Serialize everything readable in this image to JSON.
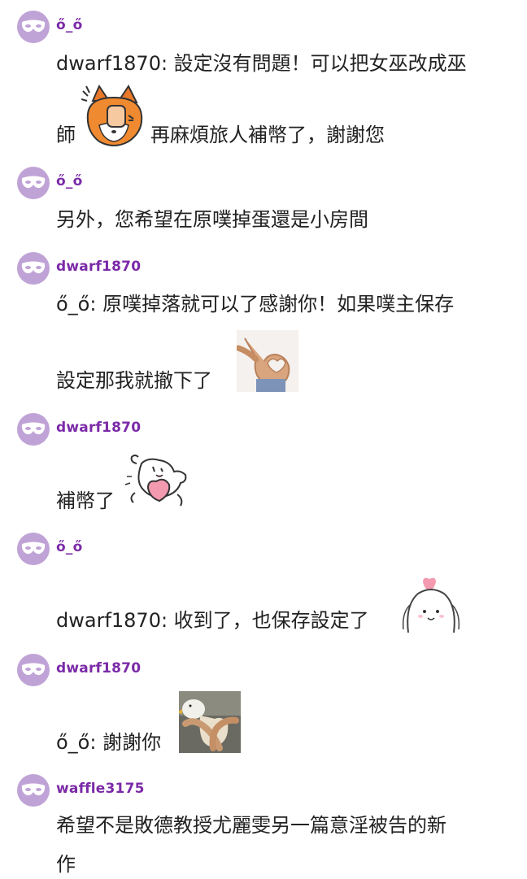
{
  "colors": {
    "username": "#7b2aa8",
    "avatar_bg": "#c0a3d6",
    "text": "#222222"
  },
  "comments": [
    {
      "username": "ő_ő",
      "lines": [
        "dwarf1870: 設定沒有問題！可以把女巫改成巫",
        "再麻煩旅人補幣了，謝謝您"
      ],
      "line2_prefix": "師",
      "sticker": "fox-facepalm-sticker"
    },
    {
      "username": "ő_ő",
      "lines": [
        "另外，您希望在原噗掉蛋還是小房間"
      ]
    },
    {
      "username": "dwarf1870",
      "lines": [
        "ő_ő: 原噗掉落就可以了感謝你！如果噗主保存",
        "設定那我就撤下了"
      ],
      "sticker": "ok-hand-heart-sticker"
    },
    {
      "username": "dwarf1870",
      "lines": [
        "補幣了"
      ],
      "sticker": "bunny-heart-sticker"
    },
    {
      "username": "ő_ő",
      "lines": [
        "dwarf1870: 收到了，也保存設定了"
      ],
      "sticker": "heart-blob-sticker"
    },
    {
      "username": "dwarf1870",
      "lines": [
        "ő_ő: 謝謝你"
      ],
      "sticker": "duck-heart-sticker"
    },
    {
      "username": "waffle3175",
      "lines": [
        "希望不是敗德教授尤麗雯另一篇意淫被告的新",
        "作"
      ]
    }
  ]
}
